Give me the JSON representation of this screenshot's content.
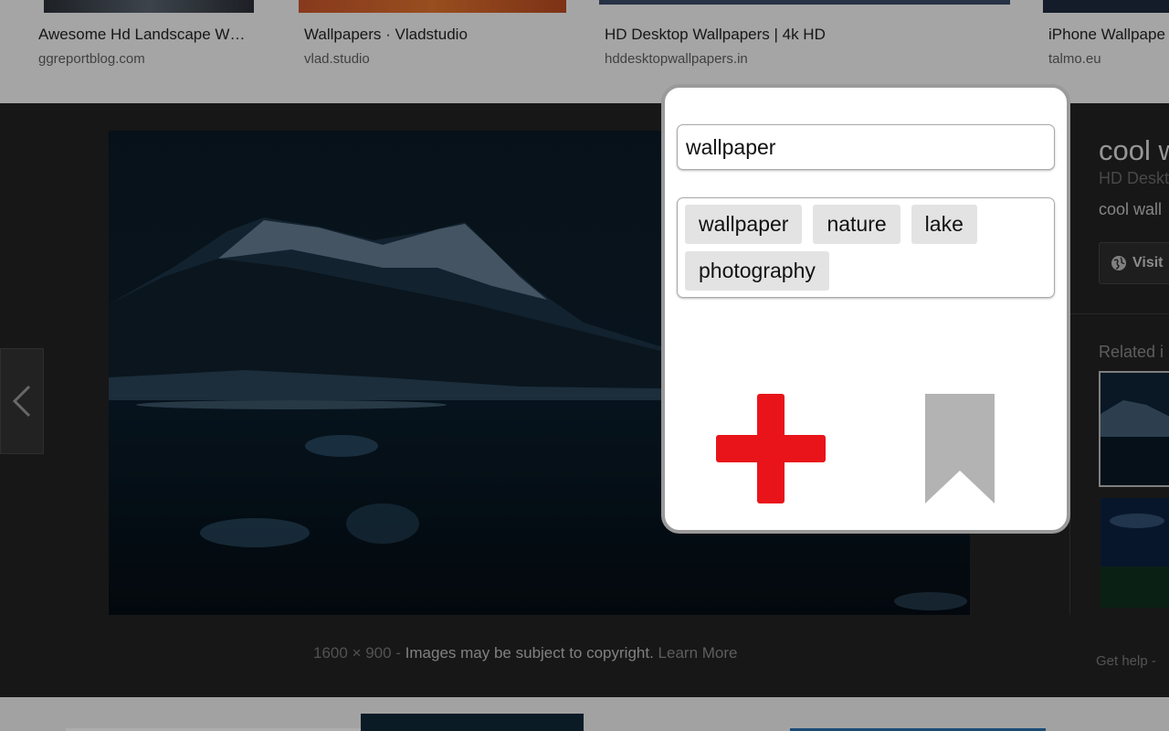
{
  "results": [
    {
      "title": "Awesome Hd Landscape W…",
      "domain": "ggreportblog.com"
    },
    {
      "title": "Wallpapers · Vladstudio",
      "domain": "vlad.studio"
    },
    {
      "title": "HD Desktop Wallpapers | 4k HD",
      "domain": "hddesktopwallpapers.in"
    },
    {
      "title": "iPhone Wallpape",
      "domain": "talmo.eu"
    }
  ],
  "viewer": {
    "caption_size": "1600 × 900",
    "caption_sep": " - ",
    "caption_copyright": "Images may be subject to copyright.",
    "caption_learn": "Learn More",
    "side_title": "cool w",
    "side_subtitle": "HD Deskt",
    "side_desc": "cool wall",
    "visit_label": "Visit",
    "related_label": "Related i",
    "get_help": "Get help  -"
  },
  "popup": {
    "input_value": "wallpaper",
    "tags": [
      "wallpaper",
      "nature",
      "lake",
      "photography"
    ],
    "colors": {
      "add": "#e8141a",
      "bookmark": "#b3b3b3"
    },
    "icons": {
      "add": "plus-icon",
      "save": "bookmark-icon"
    }
  }
}
